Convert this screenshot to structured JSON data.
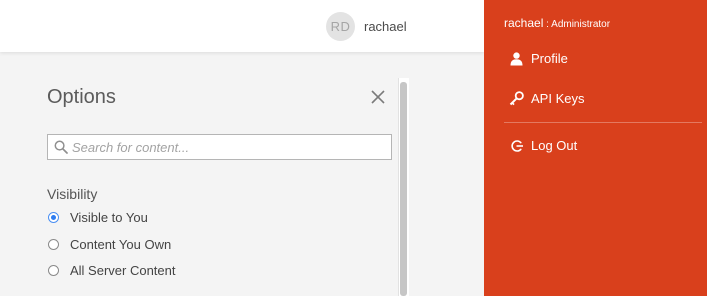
{
  "header": {
    "user": {
      "initials": "RD",
      "name": "rachael"
    }
  },
  "options": {
    "title": "Options",
    "search": {
      "placeholder": "Search for content...",
      "value": ""
    },
    "visibility": {
      "label": "Visibility",
      "options": [
        {
          "label": "Visible to You",
          "checked": true
        },
        {
          "label": "Content You Own",
          "checked": false
        },
        {
          "label": "All Server Content",
          "checked": false
        }
      ]
    }
  },
  "user_menu": {
    "username": "rachael",
    "role": " : Administrator",
    "items": [
      {
        "label": "Profile",
        "icon": "user-icon"
      },
      {
        "label": "API Keys",
        "icon": "key-icon"
      },
      {
        "label": "Log Out",
        "icon": "logout-icon"
      }
    ]
  },
  "colors": {
    "accent": "#d9401c",
    "radio_selected": "#2d7cf0"
  }
}
